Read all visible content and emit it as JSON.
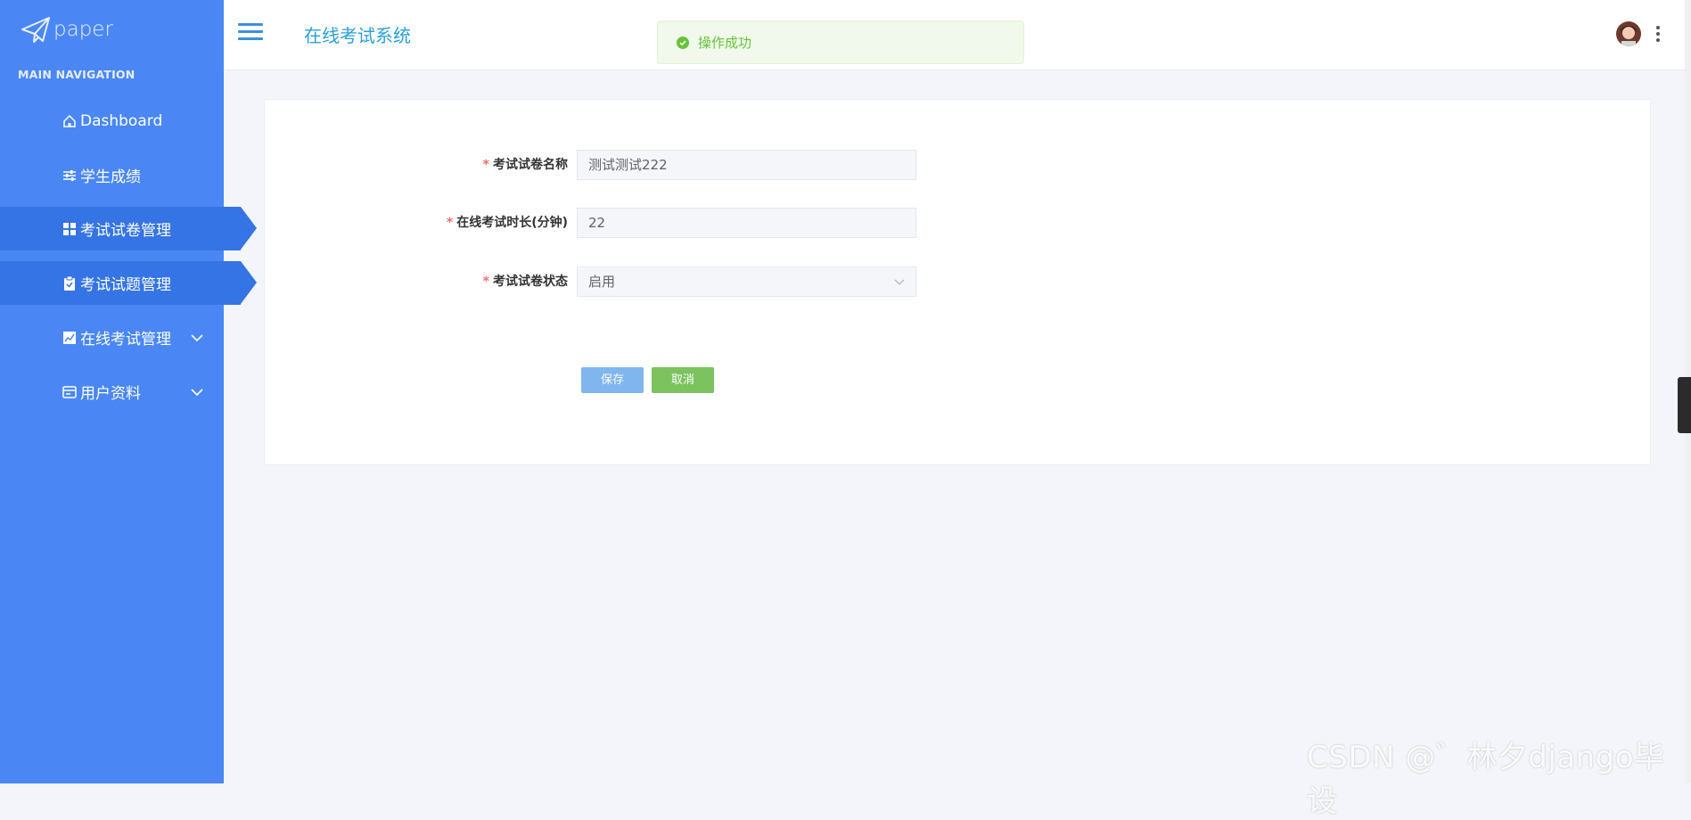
{
  "sidebar": {
    "logo_text": "paper",
    "nav_header": "MAIN NAVIGATION",
    "items": [
      {
        "label": "Dashboard",
        "icon": "home-icon"
      },
      {
        "label": "学生成绩",
        "icon": "sliders-icon"
      },
      {
        "label": "考试试卷管理",
        "icon": "grid-icon"
      },
      {
        "label": "考试试题管理",
        "icon": "clipboard-icon"
      },
      {
        "label": "在线考试管理",
        "icon": "chart-icon"
      },
      {
        "label": "用户资料",
        "icon": "card-icon"
      }
    ]
  },
  "header": {
    "title": "在线考试系统"
  },
  "toast": {
    "message": "操作成功"
  },
  "form": {
    "paper_name": {
      "label": "考试试卷名称",
      "value": "测试测试222"
    },
    "duration": {
      "label": "在线考试时长(分钟)",
      "value": "22"
    },
    "status": {
      "label": "考试试卷状态",
      "value": "启用"
    },
    "required_mark": "*",
    "save_label": "保存",
    "cancel_label": "取消"
  },
  "watermark": "CSDN @゛林夕django毕设",
  "colors": {
    "sidebar_bg": "#4a87f5",
    "sidebar_active": "#3574e4",
    "title": "#2a9fd8",
    "success": "#67c23a",
    "save_btn": "#7fb6ee",
    "cancel_btn": "#7cc35f"
  }
}
